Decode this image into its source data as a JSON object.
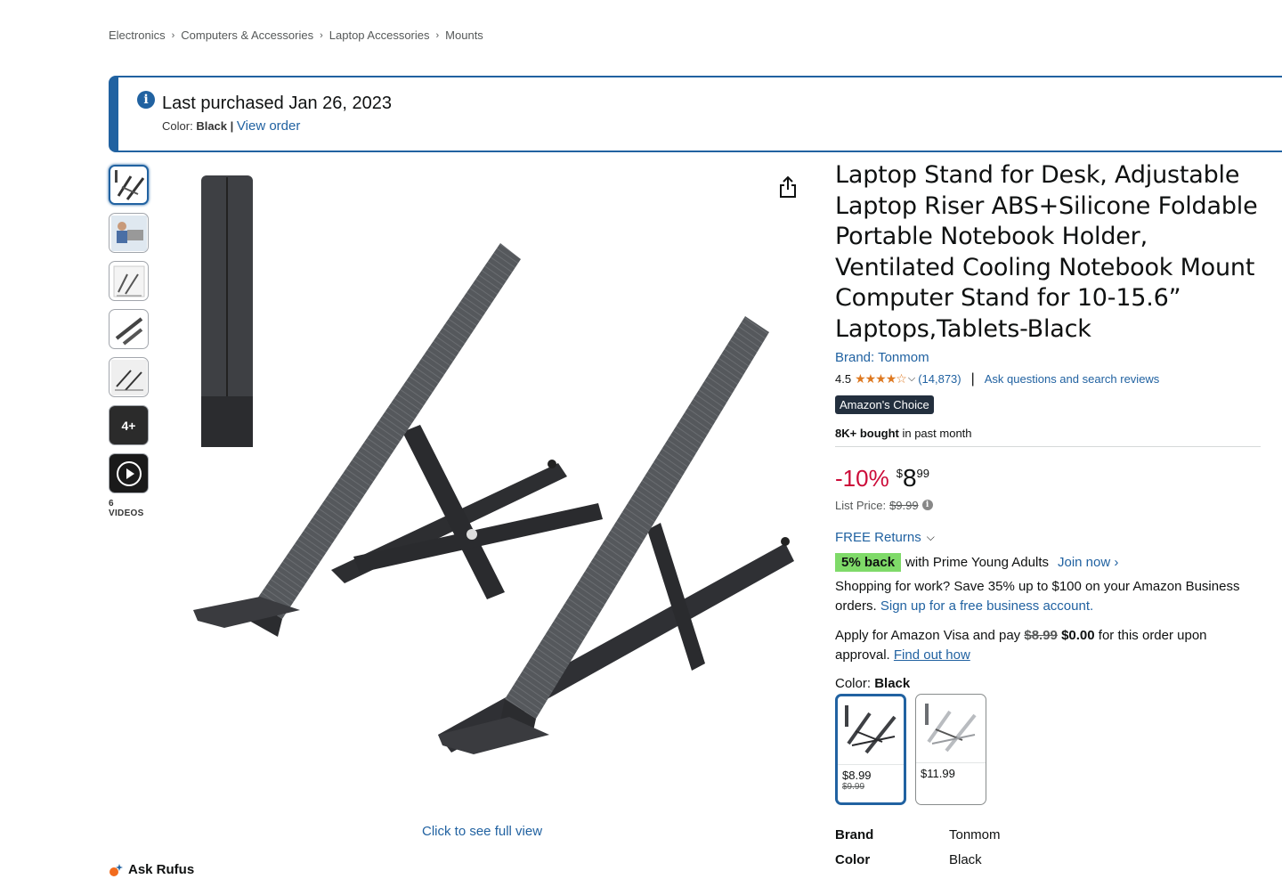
{
  "breadcrumb": [
    "Electronics",
    "Computers & Accessories",
    "Laptop Accessories",
    "Mounts"
  ],
  "breadcrumb_sep": "›",
  "alert": {
    "title": "Last purchased Jan 26, 2023",
    "color_prefix": "Color:",
    "color_value": "Black",
    "divider": "|",
    "view_order": "View order"
  },
  "gallery": {
    "more_count": "4+",
    "videos_label": "6 VIDEOS",
    "click_full_view": "Click to see full view"
  },
  "rufus": "Ask Rufus",
  "product": {
    "title": "Laptop Stand for Desk, Adjustable Laptop Riser ABS+Silicone Foldable Portable Notebook Holder, Ventilated Cooling Notebook Mount Computer Stand for 10-15.6” Laptops,Tablets-Black",
    "brand": "Brand: Tonmom",
    "rating": "4.5",
    "stars": "★★★★☆",
    "rating_count": "(14,873)",
    "ask_link": "Ask questions and search reviews",
    "badge": "Amazon's Choice",
    "bought_bold": "8K+ bought",
    "bought_rest": " in past month"
  },
  "price": {
    "discount": "-10%",
    "currency": "$",
    "whole": "8",
    "fraction": "99",
    "list_label": "List Price:",
    "list_value": "$9.99"
  },
  "returns": "FREE Returns",
  "prime": {
    "badge": "5% back",
    "text": "with Prime Young Adults",
    "join": "Join now ›"
  },
  "business": {
    "text": "Shopping for work? Save 35% up to $100 on your Amazon Business orders.",
    "link": "Sign up for a free business account."
  },
  "visa": {
    "text_before": "Apply for Amazon Visa and pay ",
    "old": "$8.99",
    "new": "$0.00",
    "text_after": " for this order upon approval.",
    "link": "Find out how"
  },
  "color": {
    "label": "Color:",
    "value": "Black",
    "swatches": [
      {
        "price": "$8.99",
        "old": "$9.99"
      },
      {
        "price": "$11.99",
        "old": ""
      }
    ]
  },
  "specs": [
    {
      "key": "Brand",
      "value": "Tonmom"
    },
    {
      "key": "Color",
      "value": "Black"
    }
  ],
  "colors": {
    "link": "#2162a1",
    "discount": "#cc0c39",
    "star": "#de7921",
    "badge_bg": "#232f3e",
    "prime_green": "#7fda69"
  }
}
